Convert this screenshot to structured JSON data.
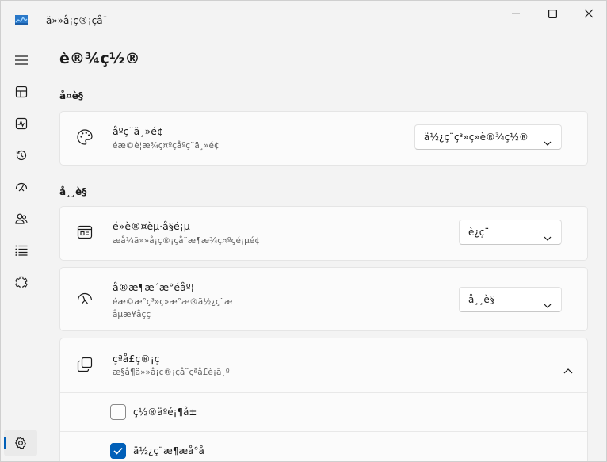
{
  "window": {
    "title": "ä»»å¡ç®¡çå¨",
    "icon": "task-manager-icon"
  },
  "nav": {
    "items": [
      {
        "icon": "hamburger-icon"
      },
      {
        "icon": "processes-icon"
      },
      {
        "icon": "performance-icon"
      },
      {
        "icon": "app-history-icon"
      },
      {
        "icon": "startup-apps-icon"
      },
      {
        "icon": "users-icon"
      },
      {
        "icon": "details-icon"
      },
      {
        "icon": "services-icon"
      }
    ],
    "selected": {
      "icon": "settings-icon"
    }
  },
  "page": {
    "title": "è®¾ç½®"
  },
  "sections": {
    "appearance": {
      "title": "å¤è§",
      "theme": {
        "title": "åºç¨ä¸»é¢",
        "description": "éæ©è¦æ¾ç¤ºçåºç¨ä¸»é¢",
        "value": "ä½¿ç¨ç³»ç»è®¾ç½®"
      }
    },
    "behavior": {
      "title": "å¸¸è§",
      "default_page": {
        "title": "é»è®¤èµ·å§é¡µ",
        "description": "æå¼ä»»å¡ç®¡çå¨æ¶æ¾ç¤ºçé¡µé¢",
        "value": "è¿ç¨"
      },
      "realtime_speed": {
        "title": "å®æ¶æ´æ°éåº¦",
        "description_lines": [
          "éæ©æ°ç³»ç»æ°æ®ä½¿ç¨æ",
          "åµæ¥åçç"
        ],
        "value": "å¸¸è§"
      },
      "window_management": {
        "title": "çªå£ç®¡ç",
        "description": "æ§å¶ä»»å¡ç®¡çå¨çªå£è¡ä¸º",
        "options": [
          {
            "label": "ç½®äºé¡¶å±",
            "checked": false
          },
          {
            "label": "ä½¿ç¨æ¶æå°å",
            "checked": true
          }
        ]
      }
    }
  },
  "colors": {
    "accent": "#005fb8",
    "background": "#f3f3f3",
    "card": "#fbfbfb"
  }
}
